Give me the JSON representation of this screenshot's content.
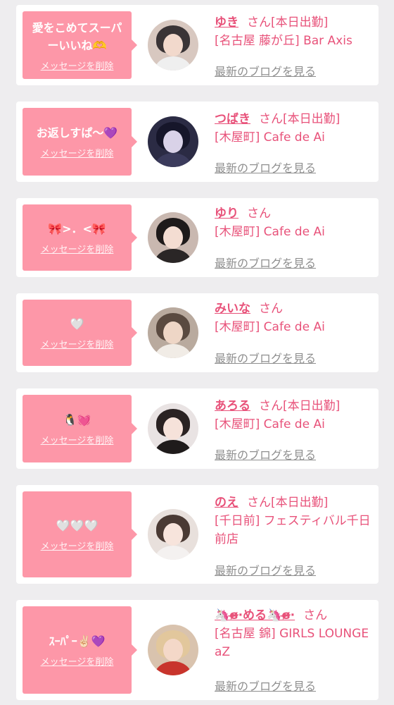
{
  "delete_label": "メッセージを削除",
  "blog_label": "最新のブログを見る",
  "honorific": "さん",
  "cards": [
    {
      "message": "愛をこめてスーパ\nーいいね🫶",
      "name": "ゆき",
      "status": "[本日出勤]",
      "shop": "[名古屋 藤が丘] Bar Axis"
    },
    {
      "message": "お返しすぱ〜💜",
      "name": "つばき",
      "status": "[本日出勤]",
      "shop": "[木屋町] Cafe de Ai"
    },
    {
      "message": "🎀>．<🎀",
      "name": "ゆり",
      "status": "",
      "shop": "[木屋町] Cafe de Ai"
    },
    {
      "message": "🤍",
      "name": "みいな",
      "status": "",
      "shop": "[木屋町] Cafe de Ai"
    },
    {
      "message": "🐧💓",
      "name": "あろる",
      "status": "[本日出勤]",
      "shop": "[木屋町] Cafe de Ai"
    },
    {
      "message": "🤍🤍🤍",
      "name": "のえ",
      "status": "[本日出勤]",
      "shop": "[千日前] フェスティバル千日前店"
    },
    {
      "message": "ｽｰﾊﾟｰ✌🏻💜",
      "name": "🦄ɞ̴̶̷·める🦄ɞ̴̶̷·",
      "status": "",
      "shop": "[名古屋 錦] GIRLS LOUNGE aZ"
    }
  ],
  "colors": {
    "accent": "#e8527a",
    "bubble": "#fd97a8",
    "background": "#eeedef"
  }
}
